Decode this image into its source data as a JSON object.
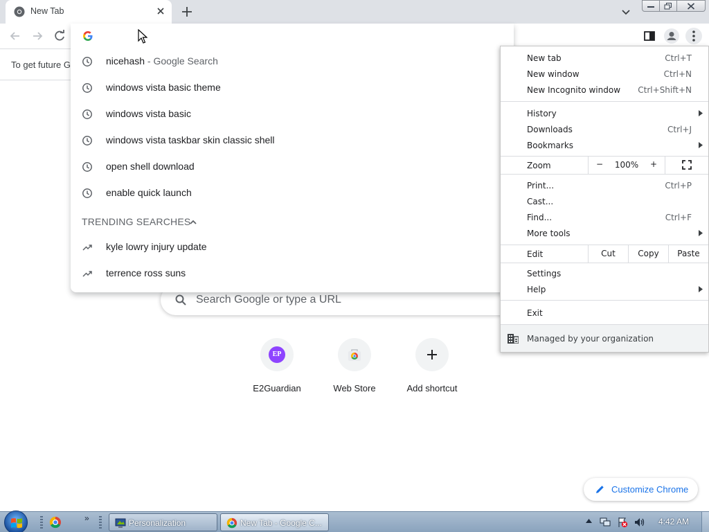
{
  "tab": {
    "title": "New Tab",
    "favicon": "chrome-icon"
  },
  "infobar": {
    "text": "To get future G"
  },
  "omnibox": {
    "value": "",
    "suggestions": [
      {
        "text": "nicehash",
        "desc": " - Google Search",
        "icon": "history-icon"
      },
      {
        "text": "windows vista basic theme",
        "desc": "",
        "icon": "history-icon"
      },
      {
        "text": "windows vista basic",
        "desc": "",
        "icon": "history-icon"
      },
      {
        "text": "windows vista taskbar skin classic shell",
        "desc": "",
        "icon": "history-icon"
      },
      {
        "text": "open shell download",
        "desc": "",
        "icon": "history-icon"
      },
      {
        "text": "enable quick launch",
        "desc": "",
        "icon": "history-icon"
      }
    ],
    "trending_header": "TRENDING SEARCHES",
    "trending": [
      {
        "text": "kyle lowry injury update",
        "icon": "trending-icon"
      },
      {
        "text": "terrence ross suns",
        "icon": "trending-icon"
      }
    ]
  },
  "ntp": {
    "search_placeholder": "Search Google or type a URL",
    "shortcuts": [
      {
        "label": "E2Guardian",
        "badge": "EP"
      },
      {
        "label": "Web Store"
      },
      {
        "label": "Add shortcut"
      }
    ],
    "customize_label": "Customize Chrome"
  },
  "menu": {
    "new_tab": {
      "label": "New tab",
      "shortcut": "Ctrl+T"
    },
    "new_window": {
      "label": "New window",
      "shortcut": "Ctrl+N"
    },
    "new_incognito": {
      "label": "New Incognito window",
      "shortcut": "Ctrl+Shift+N"
    },
    "history": {
      "label": "History"
    },
    "downloads": {
      "label": "Downloads",
      "shortcut": "Ctrl+J"
    },
    "bookmarks": {
      "label": "Bookmarks"
    },
    "zoom": {
      "label": "Zoom",
      "minus": "−",
      "level": "100%",
      "plus": "+"
    },
    "print": {
      "label": "Print...",
      "shortcut": "Ctrl+P"
    },
    "cast": {
      "label": "Cast..."
    },
    "find": {
      "label": "Find...",
      "shortcut": "Ctrl+F"
    },
    "more_tools": {
      "label": "More tools"
    },
    "edit": {
      "label": "Edit",
      "cut": "Cut",
      "copy": "Copy",
      "paste": "Paste"
    },
    "settings": {
      "label": "Settings"
    },
    "help": {
      "label": "Help"
    },
    "exit": {
      "label": "Exit"
    },
    "managed": {
      "label": "Managed by your organization"
    }
  },
  "taskbar": {
    "tasks": [
      {
        "label": "Personalization"
      },
      {
        "label": "New Tab - Google C..."
      }
    ],
    "quick_launch_more": "»",
    "clock": "4:42 AM"
  },
  "colors": {
    "accent": "#1a73e8",
    "tabstrip": "#dee1e6",
    "badge": "#8e44ff",
    "taskbar": "#9fb3c9"
  }
}
